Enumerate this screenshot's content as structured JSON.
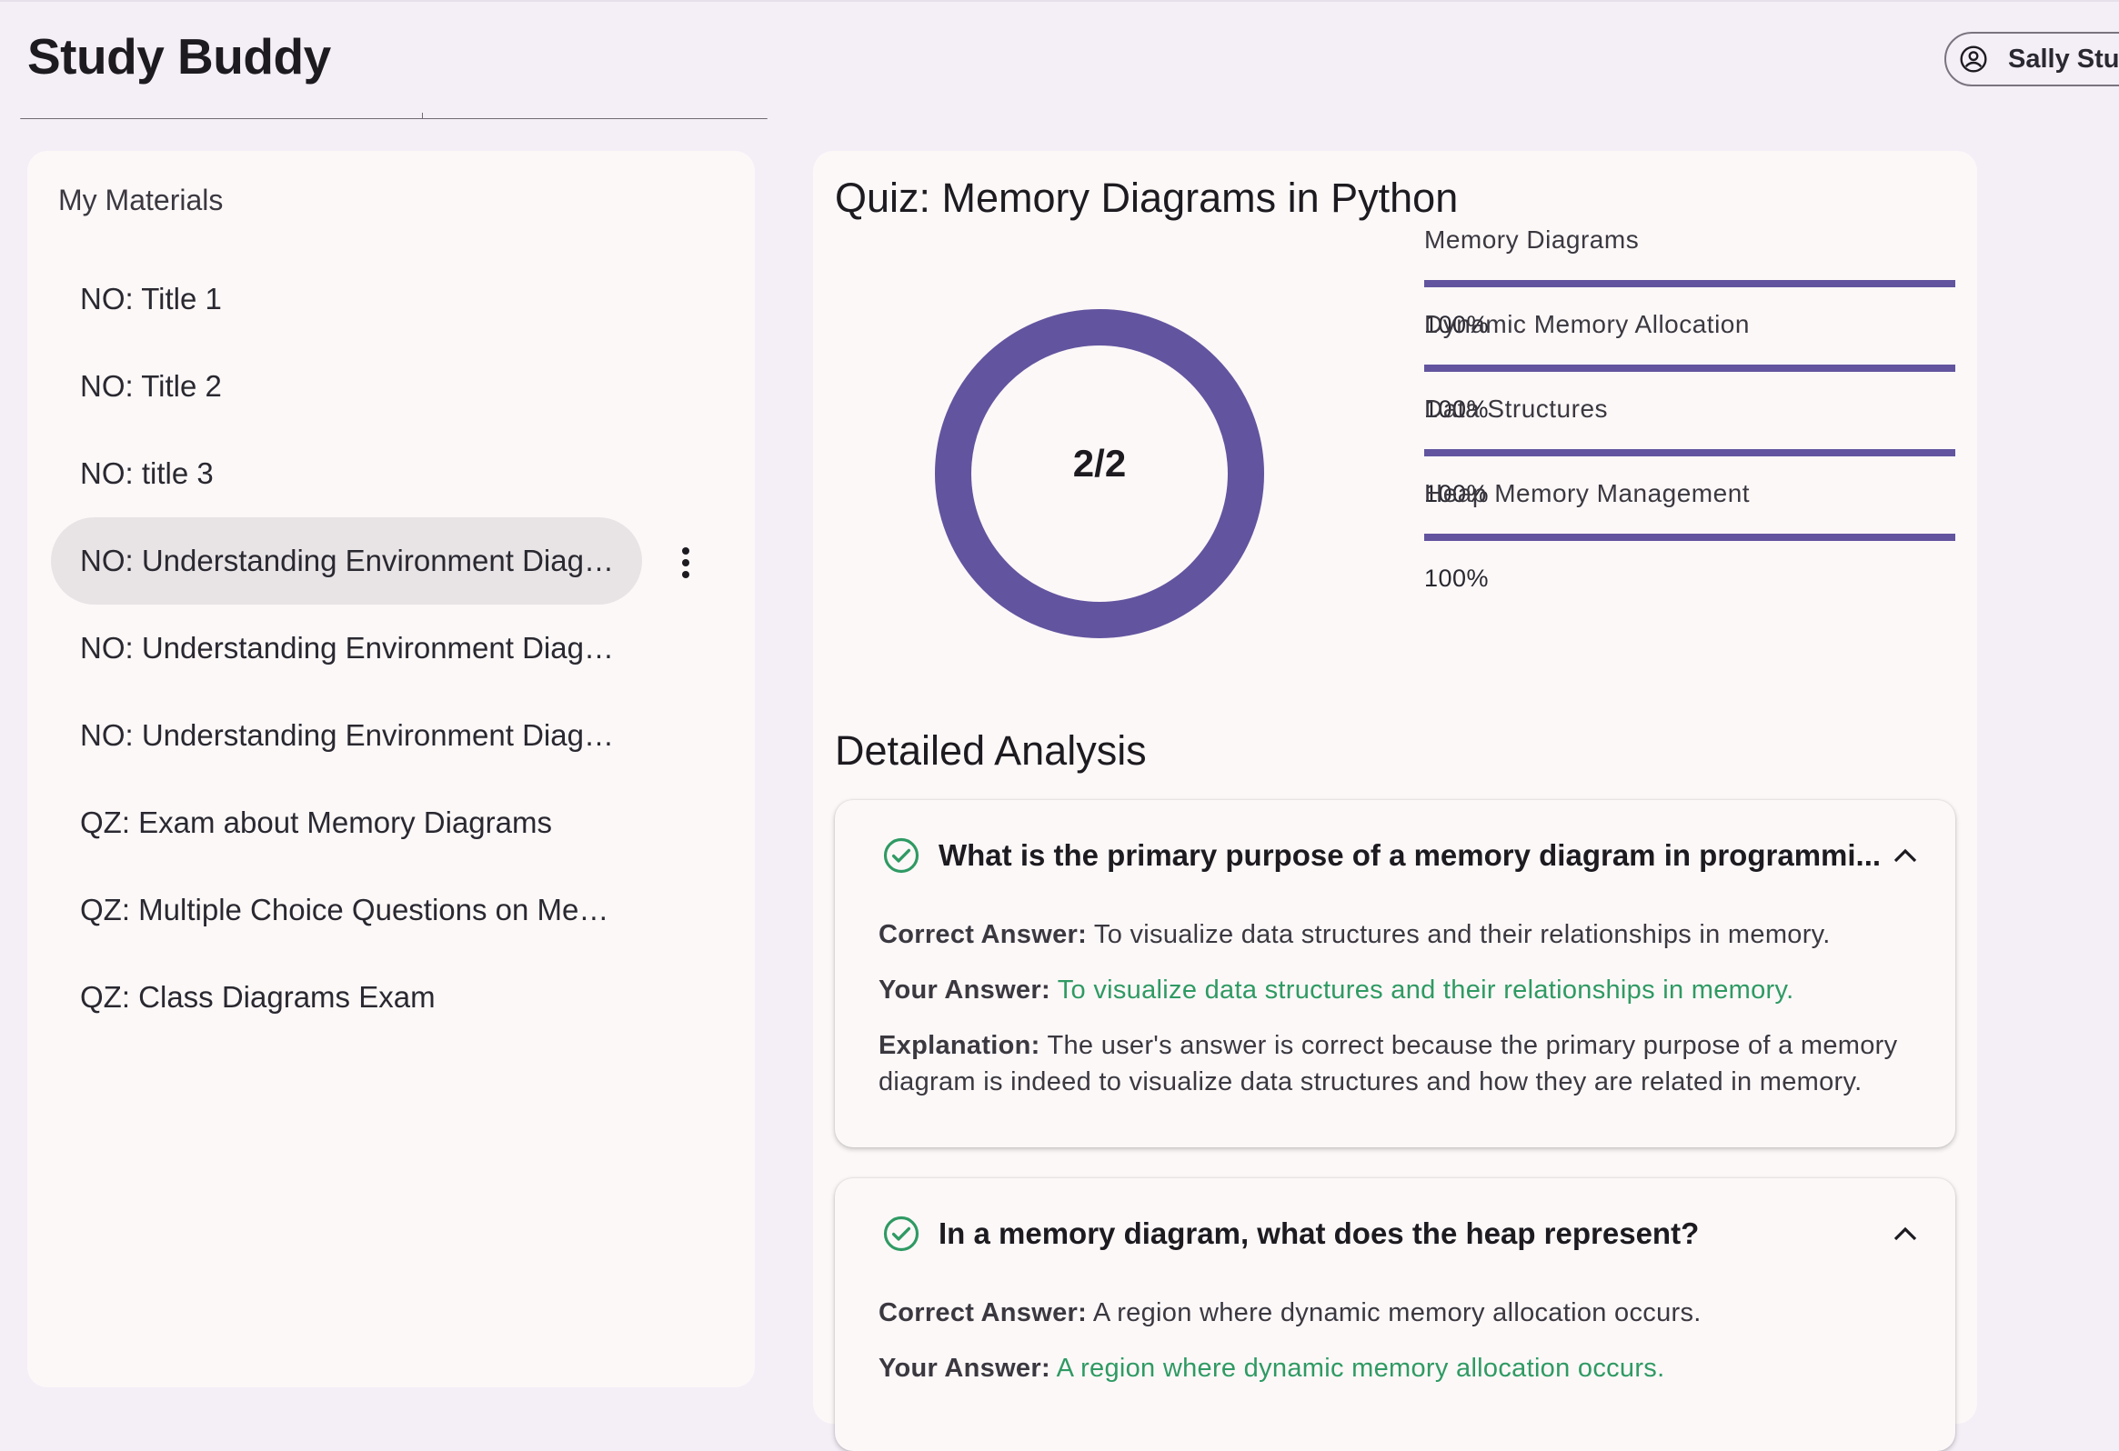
{
  "app": {
    "title": "Study Buddy"
  },
  "user": {
    "name": "Sally Student"
  },
  "sidebar": {
    "title": "My Materials",
    "items": [
      {
        "label": "NO: Title 1"
      },
      {
        "label": "NO: Title 2"
      },
      {
        "label": "NO: title 3"
      },
      {
        "label": "NO: Understanding Environment Diag…",
        "active": true
      },
      {
        "label": "NO: Understanding Environment Diag…"
      },
      {
        "label": "NO: Understanding Environment Diag…"
      },
      {
        "label": "QZ: Exam about Memory Diagrams"
      },
      {
        "label": "QZ: Multiple Choice Questions on Me…"
      },
      {
        "label": "QZ: Class Diagrams Exam"
      }
    ]
  },
  "quiz": {
    "title": "Quiz: Memory Diagrams in Python",
    "score": "2/2",
    "score_fraction": 1.0,
    "topics": [
      {
        "name": "Memory Diagrams",
        "percent": "100%",
        "value": 100
      },
      {
        "name": "Dynamic Memory Allocation",
        "percent": "100%",
        "value": 100
      },
      {
        "name": "Data Structures",
        "percent": "100%",
        "value": 100
      },
      {
        "name": "Heap Memory Management",
        "percent": "100%",
        "value": 100
      }
    ]
  },
  "analysis": {
    "title": "Detailed Analysis",
    "labels": {
      "correct": "Correct Answer:",
      "yours": "Your Answer:",
      "explanation": "Explanation:"
    },
    "questions": [
      {
        "question": "What is the primary purpose of a memory diagram in programmi...",
        "correct_answer": "To visualize data structures and their relationships in memory.",
        "your_answer": "To visualize data structures and their relationships in memory.",
        "explanation": "The user's answer is correct because the primary purpose of a memory diagram is indeed to visualize data structures and how they are related in memory."
      },
      {
        "question": "In a memory diagram, what does the heap represent?",
        "correct_answer": "A region where dynamic memory allocation occurs.",
        "your_answer": "A region where dynamic memory allocation occurs."
      }
    ]
  },
  "colors": {
    "accent": "#63549f",
    "success": "#2f9a63",
    "background": "#f4eef7",
    "surface": "#fcf8f8"
  },
  "icons": {
    "user": "account-circle-icon",
    "menu": "more-vert-icon",
    "correct": "check-circle-icon",
    "collapse": "chevron-up-icon"
  }
}
